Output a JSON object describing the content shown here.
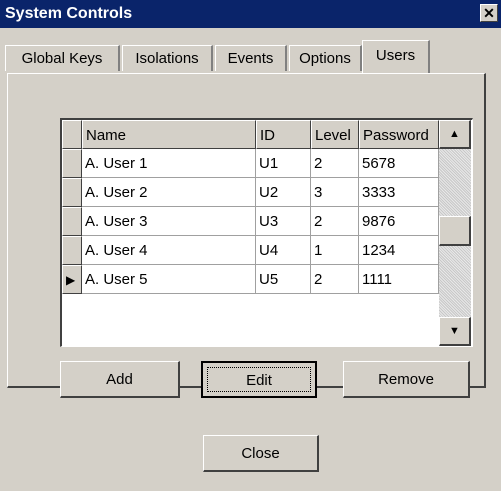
{
  "window": {
    "title": "System Controls",
    "close_glyph": "✕"
  },
  "tabs": [
    {
      "label": "Global Keys"
    },
    {
      "label": "Isolations"
    },
    {
      "label": "Events"
    },
    {
      "label": "Options"
    },
    {
      "label": "Users",
      "active": true
    }
  ],
  "grid": {
    "columns": [
      "Name",
      "ID",
      "Level",
      "Password"
    ],
    "rows": [
      {
        "name": "A. User 1",
        "id": "U1",
        "level": "2",
        "password": "5678"
      },
      {
        "name": "A. User 2",
        "id": "U2",
        "level": "3",
        "password": "3333"
      },
      {
        "name": "A. User 3",
        "id": "U3",
        "level": "2",
        "password": "9876"
      },
      {
        "name": "A. User 4",
        "id": "U4",
        "level": "1",
        "password": "1234"
      },
      {
        "name": "A. User 5",
        "id": "U5",
        "level": "2",
        "password": "1111"
      }
    ],
    "current_row_indicator": "▶",
    "scroll_up_glyph": "▲",
    "scroll_down_glyph": "▼"
  },
  "buttons": {
    "add": "Add",
    "edit": "Edit",
    "remove": "Remove",
    "close": "Close"
  }
}
